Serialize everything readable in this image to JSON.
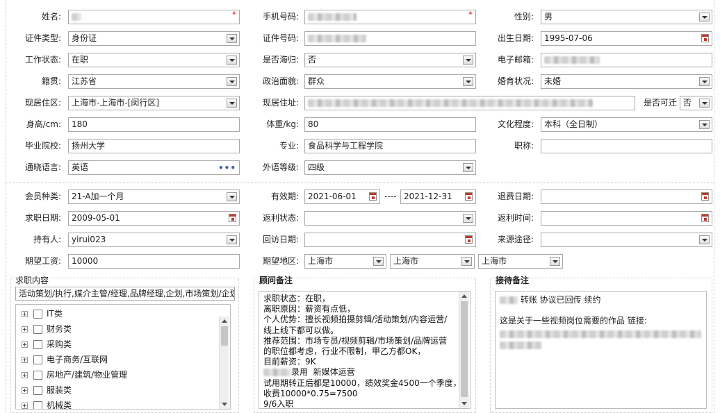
{
  "personal": {
    "name_label": "姓名:",
    "phone_label": "手机号码:",
    "gender_label": "性别:",
    "gender_value": "男",
    "id_type_label": "证件类型:",
    "id_type_value": "身份证",
    "id_no_label": "证件号码:",
    "birth_label": "出生日期:",
    "birth_value": "1995-07-06",
    "work_status_label": "工作状态:",
    "work_status_value": "在职",
    "returnee_label": "是否海归:",
    "returnee_value": "否",
    "email_label": "电子邮箱:",
    "origin_label": "籍贯:",
    "origin_value": "江苏省",
    "political_label": "政治面貌:",
    "political_value": "群众",
    "marital_label": "婚育状况:",
    "marital_value": "未婚",
    "residence_area_label": "现居住区:",
    "residence_area_value": "上海市-上海市-[闵行区]",
    "residence_addr_label": "现居住址:",
    "relocate_label": "是否可迁",
    "relocate_value": "否",
    "height_label": "身高/cm:",
    "height_value": "180",
    "weight_label": "体重/kg:",
    "weight_value": "80",
    "education_label": "文化程度:",
    "education_value": "本科（全日制）",
    "school_label": "毕业院校:",
    "school_value": "扬州大学",
    "major_label": "专业:",
    "major_value": "食品科学与工程学院",
    "title_label": "职称:",
    "title_value": "",
    "language_label": "通晓语言:",
    "language_value": "英语",
    "lang_level_label": "外语等级:",
    "lang_level_value": "四级",
    "required_mark": "*"
  },
  "membership": {
    "member_type_label": "会员种类:",
    "member_type_value": "21-A加一个月",
    "valid_label": "有效期:",
    "valid_from": "2021-06-01",
    "valid_sep": "----",
    "valid_to": "2021-12-31",
    "refund_date_label": "退费日期:",
    "refund_date_value": "",
    "job_date_label": "求职日期:",
    "job_date_value": "2009-05-01",
    "rebate_status_label": "返利状态:",
    "rebate_status_value": "",
    "rebate_time_label": "返利时间:",
    "rebate_time_value": "",
    "holder_label": "持有人:",
    "holder_value": "yirui023",
    "visit_date_label": "回访日期:",
    "visit_date_value": "",
    "source_label": "来源途径:",
    "source_value": "",
    "salary_label": "期望工资:",
    "salary_value": "10000",
    "area_label": "期望地区:",
    "area_values": [
      "上海市",
      "上海市",
      "上海市"
    ]
  },
  "job_content": {
    "title": "求职内容",
    "selected": "活动策划/执行,媒介主管/经理,品牌经理,企划,市场策划/企划",
    "categories": [
      "IT类",
      "财务类",
      "采购类",
      "电子商务/互联网",
      "房地产/建筑/物业管理",
      "服装类",
      "机械类"
    ]
  },
  "advisor_notes": {
    "title": "顾问备注",
    "text": "求职状态：在职，\n离职原因：薪资有点低，\n个人优势：擅长视频拍摄剪辑/活动策划/内容运营/\n线上线下都可以做。\n推荐范围：市场专员/视频剪辑/市场策划/品牌运营\n的职位都考虑，行业不限制，甲乙方都OK，\n目前薪资：9K",
    "line_hire": "录用  新媒体运营",
    "text2": "试用期转正后都是10000，绩效奖金4500一个季度，\n收费10000*0.75=7500\n9/6入职"
  },
  "reception_notes": {
    "title": "接待备注",
    "line1": "转账 协议已回传 续约",
    "line2": "这是关于一些视频岗位需要的作品 链接:"
  }
}
